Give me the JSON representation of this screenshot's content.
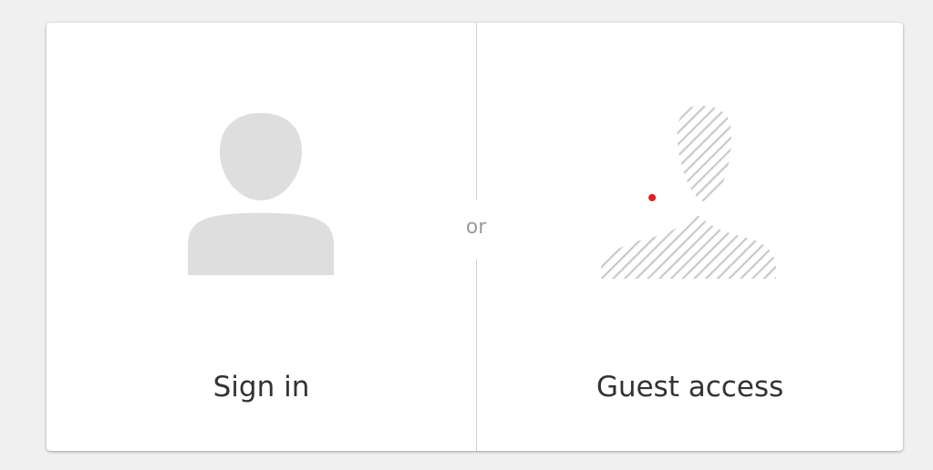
{
  "separator": {
    "text": "or"
  },
  "options": {
    "sign_in": {
      "label": "Sign in",
      "icon": "user-silhouette-icon"
    },
    "guest": {
      "label": "Guest access",
      "icon": "guest-striped-user-icon",
      "dot_color": "#e02020"
    }
  },
  "colors": {
    "page_background": "#f0f0f0",
    "card_background": "#ffffff",
    "icon_gray": "#dedede",
    "label_text": "#333333",
    "separator_text": "#9a9a9a"
  }
}
